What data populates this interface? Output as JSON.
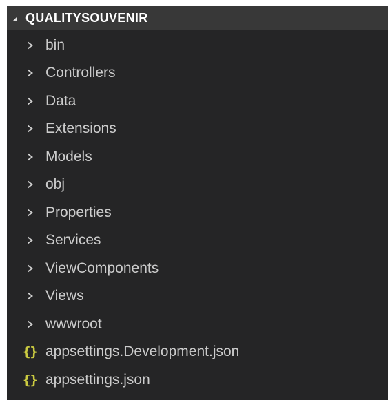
{
  "explorer": {
    "section_title": "QUALITYSOUVENIR",
    "folders": [
      {
        "label": "bin"
      },
      {
        "label": "Controllers"
      },
      {
        "label": "Data"
      },
      {
        "label": "Extensions"
      },
      {
        "label": "Models"
      },
      {
        "label": "obj"
      },
      {
        "label": "Properties"
      },
      {
        "label": "Services"
      },
      {
        "label": "ViewComponents"
      },
      {
        "label": "Views"
      },
      {
        "label": "wwwroot"
      }
    ],
    "files": [
      {
        "label": "appsettings.Development.json",
        "icon": "{}"
      },
      {
        "label": "appsettings.json",
        "icon": "{}"
      }
    ]
  },
  "colors": {
    "background": "#252526",
    "header_background": "#383838",
    "text": "#cccccc",
    "json_icon": "#cbcb41"
  }
}
